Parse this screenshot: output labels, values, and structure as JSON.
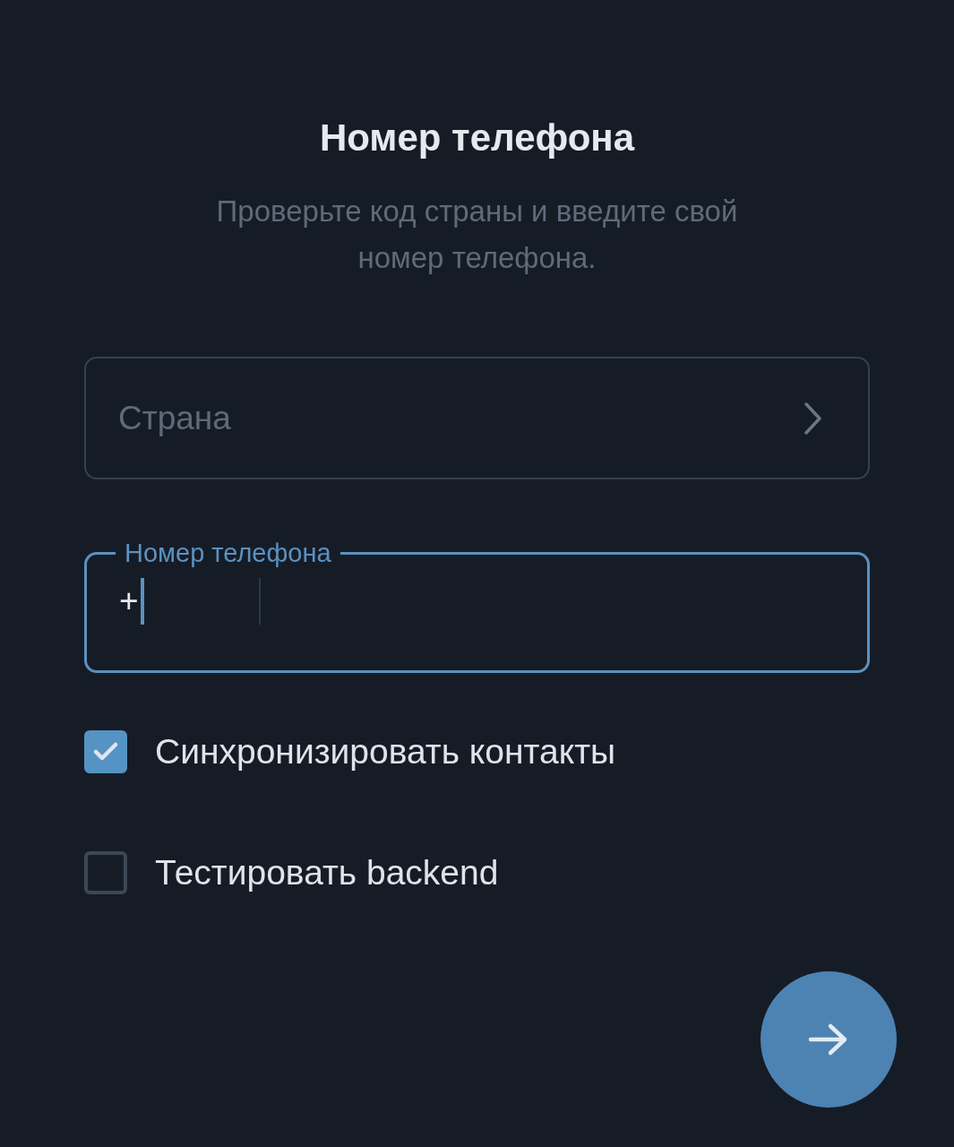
{
  "title": "Номер телефона",
  "subtitle": "Проверьте код страны и введите свой номер телефона.",
  "country_field": {
    "placeholder": "Страна"
  },
  "phone_field": {
    "label": "Номер телефона",
    "value": "+",
    "focused": true
  },
  "options": [
    {
      "label": "Синхронизировать контакты",
      "checked": true
    },
    {
      "label": "Тестировать backend",
      "checked": false
    }
  ]
}
